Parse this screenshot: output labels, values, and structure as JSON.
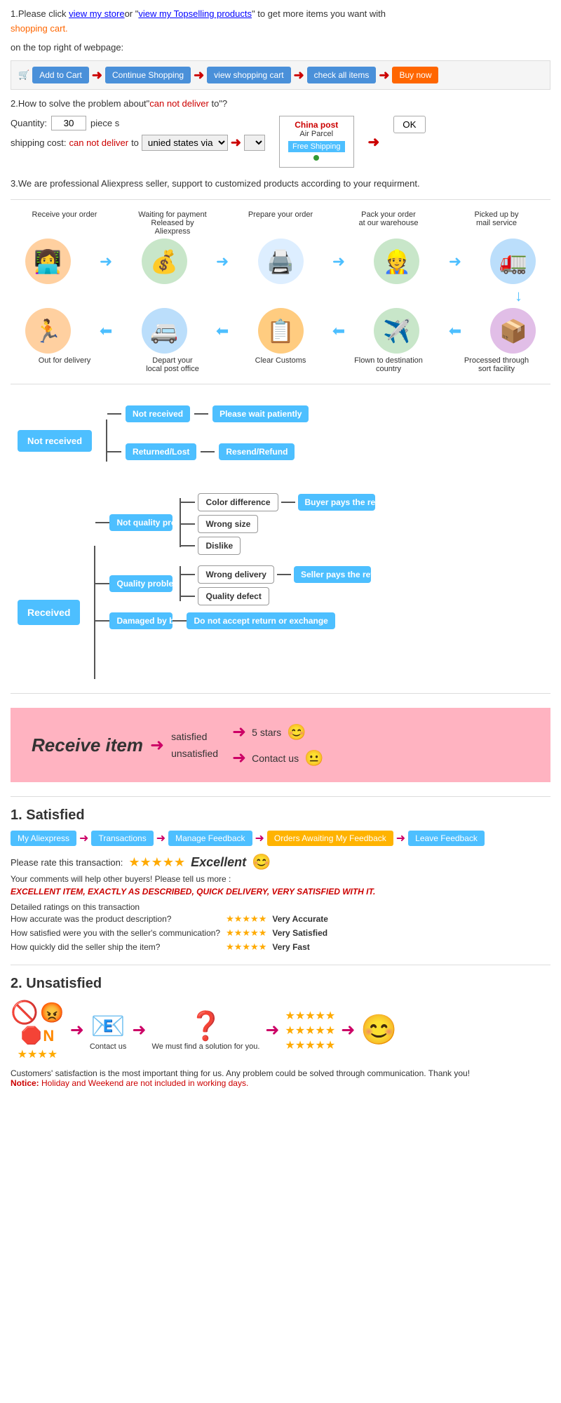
{
  "section1": {
    "text1": "1.Please click ",
    "link1": "view my store",
    "text2": "or \"",
    "link2": "view my Topselling products",
    "text3": "\" to get more items you want with",
    "link3": "shopping cart.",
    "text4": "on the top right of webpage:",
    "btn1": "Add to Cart",
    "btn2": "Continue Shopping",
    "btn3": "view shopping cart",
    "btn4": "check all items",
    "btn5": "Buy now"
  },
  "section2": {
    "title": "2.How to solve the problem about\"",
    "redText": "can not deliver",
    "titleEnd": " to\"?",
    "quantityLabel": "Quantity:",
    "quantityValue": "30",
    "piecesLabel": "piece s",
    "shippingLabel": "shipping cost:",
    "shippingRed": "can not deliver",
    "shippingTo": " to ",
    "shippingVia": "unied states via",
    "chinaPost": "China post",
    "airParcel": "Air Parcel",
    "freeShipping": "Free Shipping",
    "okBtn": "OK"
  },
  "section3": {
    "text": "3.We are professional Aliexpress seller, support to customized products according to your requirment."
  },
  "process": {
    "row1_labels": [
      "Receive your order",
      "Waiting for payment Released by Aliexpress",
      "Prepare your order",
      "Pack your order at our warehouse",
      "Picked up by mail service"
    ],
    "row1_icons": [
      "👩‍💻",
      "💰",
      "🖨️",
      "👷",
      "🚛"
    ],
    "row2_labels": [
      "Out for delivery",
      "Depart your local post office",
      "Clear Customs",
      "Flown to destination country",
      "Processed through sort facility"
    ],
    "row2_icons": [
      "🏃",
      "🚐",
      "📋",
      "✈️",
      "📦"
    ]
  },
  "decisionTree": {
    "notReceived": "Not received",
    "received": "Received",
    "notReceivedBranch1": "Not received",
    "notReceivedBranch2": "Returned/Lost",
    "result1": "Please wait patiently",
    "result2": "Resend/Refund",
    "notQuality": "Not quality problem",
    "quality": "Quality problem",
    "damagedByBuyer": "Damaged by buyer",
    "colorDiff": "Color difference",
    "wrongSize": "Wrong size",
    "dislike": "Dislike",
    "wrongDelivery": "Wrong delivery",
    "qualityDefect": "Quality defect",
    "doNotAccept": "Do not accept return or exchange",
    "buyerPays": "Buyer pays the return shipping fee",
    "sellerPays": "Seller pays the return shipping fee"
  },
  "receiveItem": {
    "title": "Receive item",
    "satisfied": "satisfied",
    "unsatisfied": "unsatisfied",
    "fiveStars": "5 stars",
    "contactUs": "Contact us"
  },
  "satisfied": {
    "sectionNum": "1.",
    "title": "Satisfied",
    "nav": [
      "My Aliexpress",
      "Transactions",
      "Manage Feedback",
      "Orders Awaiting My Feedback",
      "Leave Feedback"
    ],
    "rateLabel": "Please rate this transaction:",
    "excellentText": "Excellent",
    "commentLabel": "Your comments will help other buyers! Please tell us more :",
    "excellentItem": "EXCELLENT ITEM, EXACTLY AS DESCRIBED, QUICK DELIVERY, VERY SATISFIED WITH IT.",
    "detailedLabel": "Detailed ratings on this transaction",
    "q1": "How accurate was the product description?",
    "q2": "How satisfied were you with the seller's communication?",
    "q3": "How quickly did the seller ship the item?",
    "r1": "Very Accurate",
    "r2": "Very Satisfied",
    "r3": "Very Fast"
  },
  "unsatisfied": {
    "sectionNum": "2.",
    "title": "Unsatisfied",
    "step1Icon": "🚫",
    "step2Icon": "📧",
    "step3Icon": "❓",
    "step4Icon": "⭐",
    "step2Label": "Contact us",
    "step3Label": "We must find a solution for you.",
    "footerText": "Customers' satisfaction is the most important thing for us. Any problem could be solved through communication. Thank you!",
    "noticeLabel": "Notice: ",
    "noticeText": "Holiday and Weekend are not included in working days."
  }
}
